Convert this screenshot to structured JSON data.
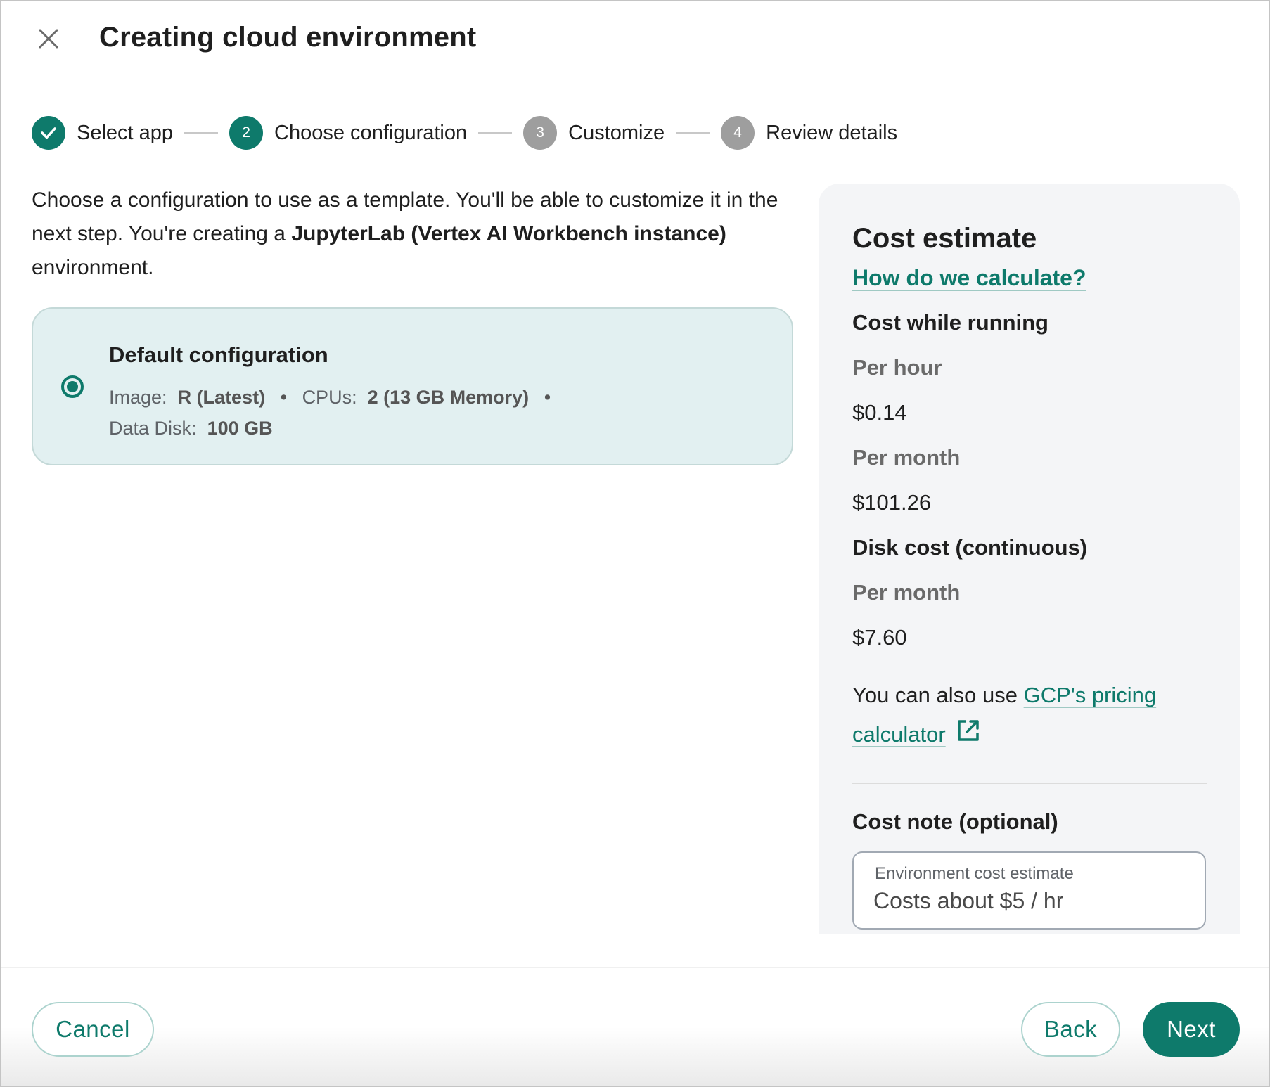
{
  "header": {
    "title": "Creating cloud environment",
    "close_icon": "close-icon"
  },
  "stepper": {
    "steps": [
      {
        "number": "1",
        "label": "Select app",
        "state": "completed",
        "icon": "check-icon"
      },
      {
        "number": "2",
        "label": "Choose configuration",
        "state": "current"
      },
      {
        "number": "3",
        "label": "Customize",
        "state": "upcoming"
      },
      {
        "number": "4",
        "label": "Review details",
        "state": "upcoming"
      }
    ]
  },
  "intro": {
    "text_before": "Choose a configuration to use as a template. You'll be able to customize it in the next step. You're creating a ",
    "app_name": "JupyterLab (Vertex AI Workbench instance)",
    "text_after": " environment."
  },
  "configurations": [
    {
      "title": "Default configuration",
      "selected": true,
      "image_label": "Image:",
      "image_value": "R (Latest)",
      "cpus_label": "CPUs:",
      "cpus_value": "2 (13 GB Memory)",
      "disk_label": "Data Disk:",
      "disk_value": "100 GB",
      "separator": "•"
    }
  ],
  "cost_estimate": {
    "title": "Cost estimate",
    "how_link": "How do we calculate?",
    "running_heading": "Cost while running",
    "per_hour_label": "Per hour",
    "per_hour_value": "$0.14",
    "per_month_label": "Per month",
    "per_month_value": "$101.26",
    "disk_heading": "Disk cost (continuous)",
    "disk_per_month_label": "Per month",
    "disk_per_month_value": "$7.60",
    "note_prefix": "You can also use ",
    "calculator_link": "GCP's pricing calculator",
    "external_icon": "external-link-icon",
    "cost_note_heading": "Cost note (optional)",
    "cost_note_field_label": "Environment cost estimate",
    "cost_note_field_value": "Costs about $5 / hr"
  },
  "footer": {
    "cancel_label": "Cancel",
    "back_label": "Back",
    "next_label": "Next"
  },
  "colors": {
    "accent": "#0e7a6b",
    "card_selected_bg": "#e2f0f1",
    "panel_bg": "#f4f5f7",
    "step_upcoming": "#9e9e9e"
  }
}
